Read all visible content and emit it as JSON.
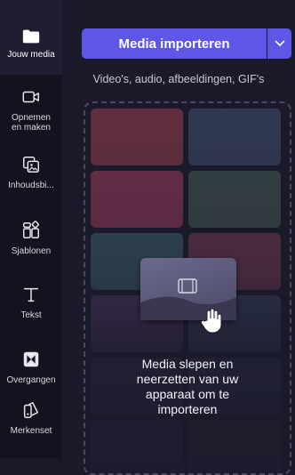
{
  "sidebar": {
    "items": [
      {
        "label": "Jouw media",
        "icon": "folder-icon"
      },
      {
        "label": "Opnemen\nen maken",
        "icon": "video-camera-icon"
      },
      {
        "label": "Inhoudsbi...",
        "icon": "content-library-icon"
      },
      {
        "label": "Sjablonen",
        "icon": "templates-icon"
      },
      {
        "label": "Tekst",
        "icon": "text-icon"
      },
      {
        "label": "Overgangen",
        "icon": "transitions-icon"
      },
      {
        "label": "Merkenset",
        "icon": "brand-kit-icon"
      }
    ]
  },
  "media": {
    "import_label": "Media importeren",
    "subtitle": "Video's, audio, afbeeldingen, GIF's",
    "drop_text": "Media slepen en\nneerzetten van uw\napparaat om te\nimporteren"
  },
  "colors": {
    "accent": "#5d56e6",
    "sidebar_bg": "#13121f",
    "panel_bg": "#1b1a2b"
  }
}
